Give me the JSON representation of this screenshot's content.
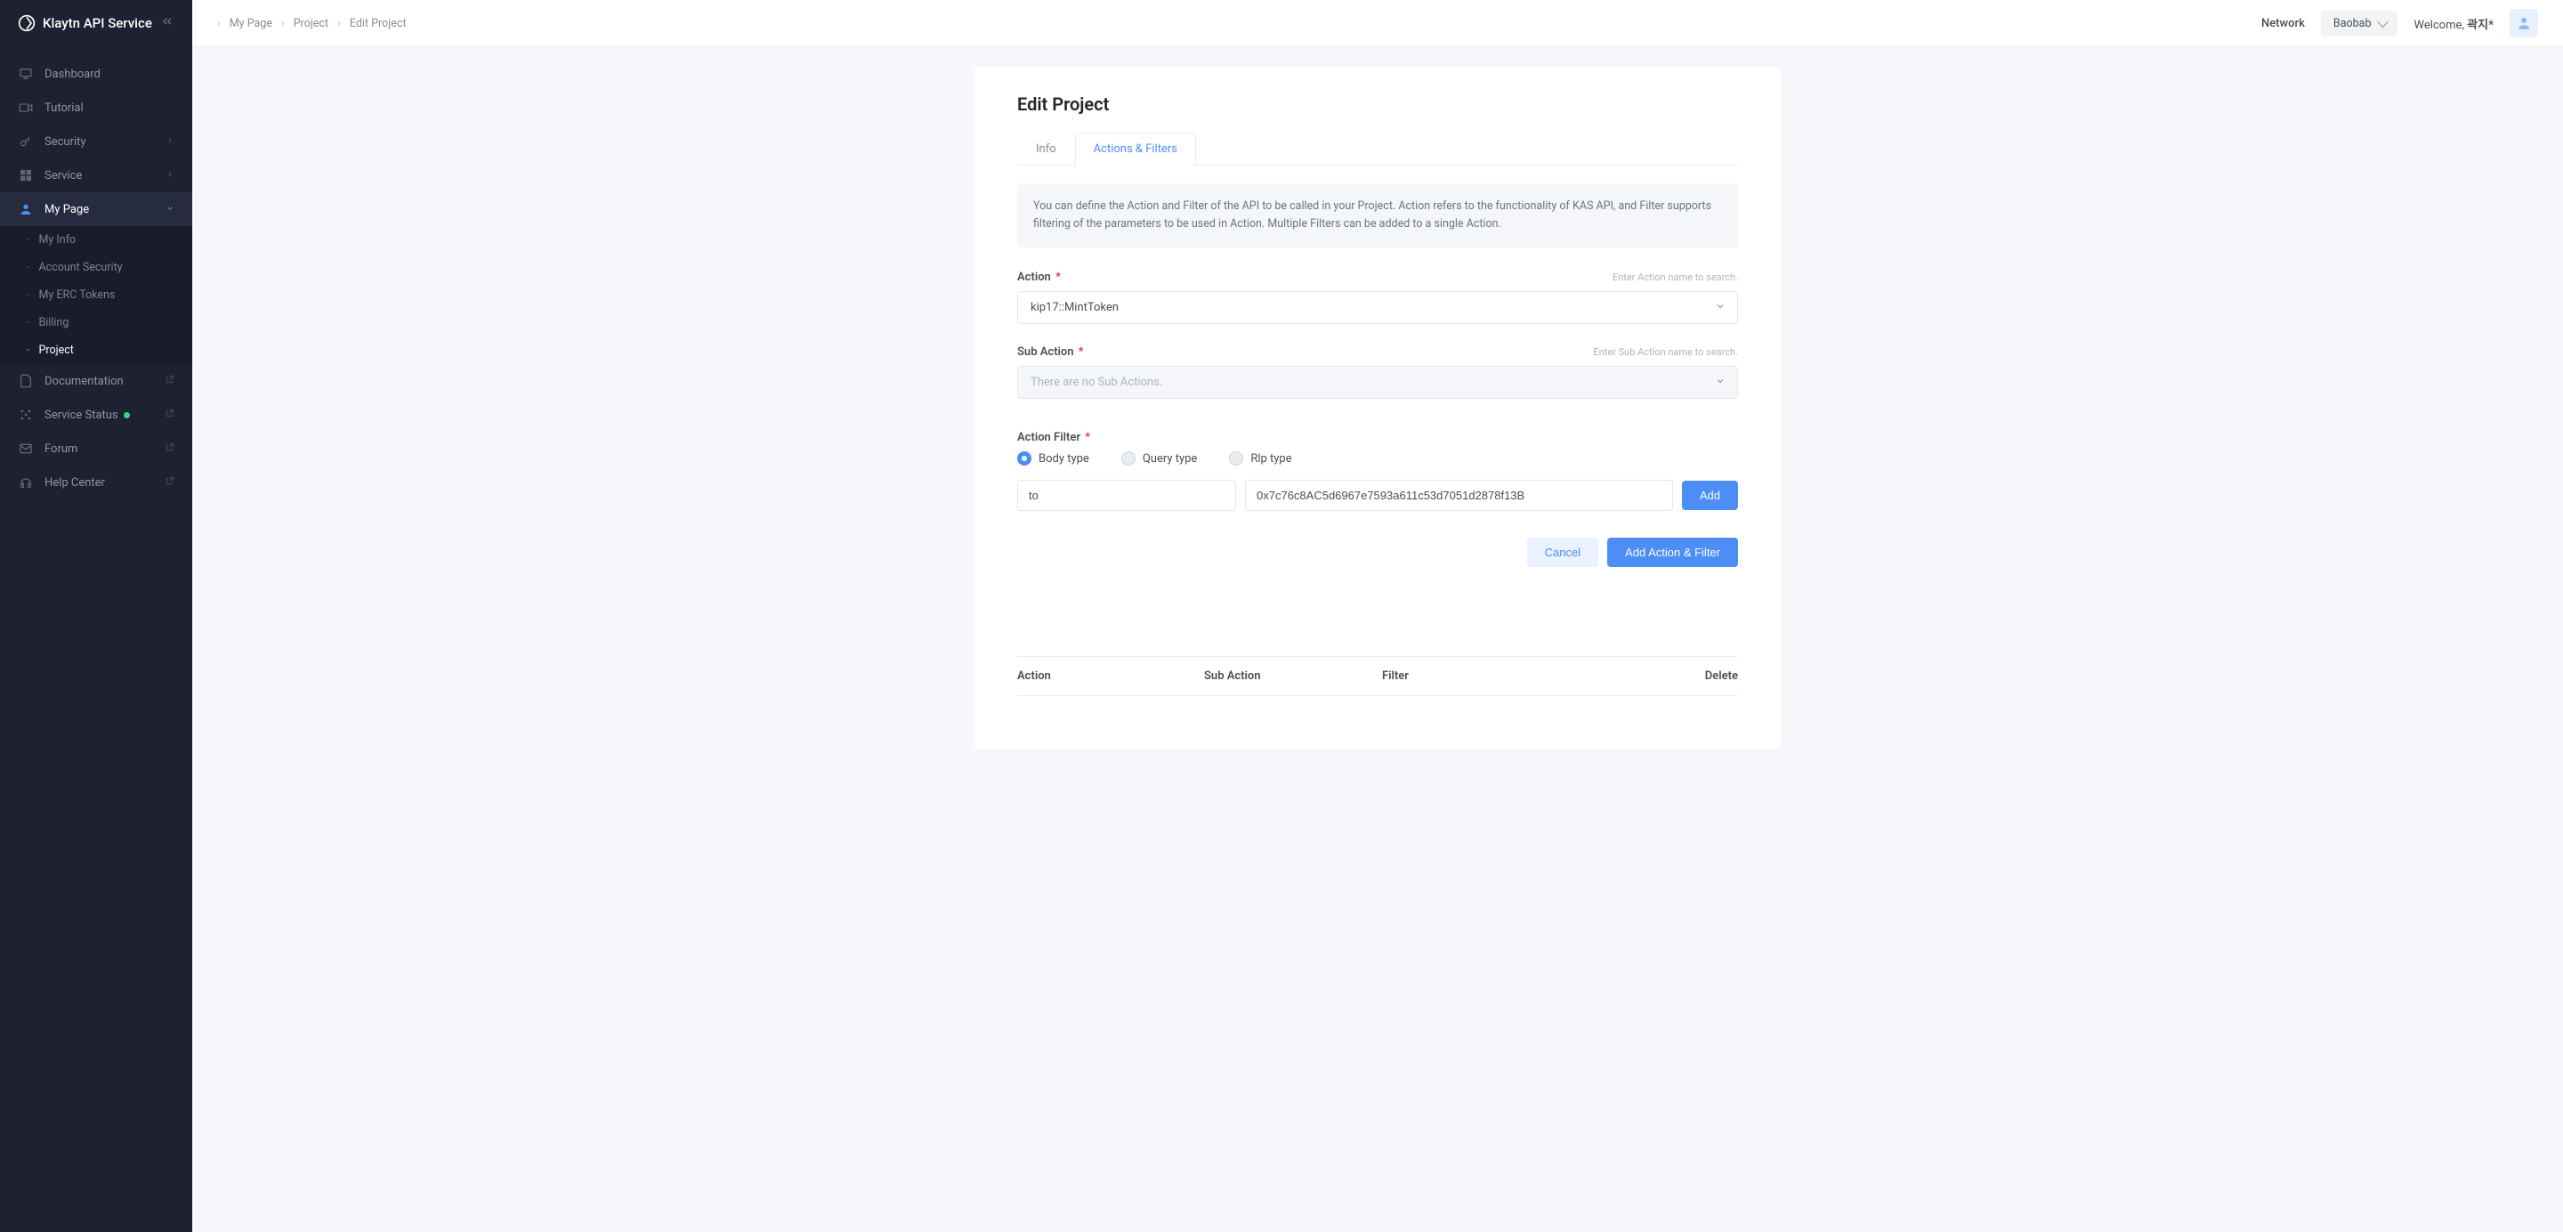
{
  "brand": "Klaytn API Service",
  "sidebar": {
    "items": {
      "dashboard": "Dashboard",
      "tutorial": "Tutorial",
      "security": "Security",
      "service": "Service",
      "mypage": "My Page",
      "documentation": "Documentation",
      "servicestatus": "Service Status",
      "forum": "Forum",
      "helpcenter": "Help Center"
    },
    "sub": {
      "myinfo": "My Info",
      "accountsecurity": "Account Security",
      "myerctokens": "My ERC Tokens",
      "billing": "Billing",
      "project": "Project"
    }
  },
  "breadcrumb": {
    "a": "My Page",
    "b": "Project",
    "c": "Edit Project"
  },
  "header": {
    "networkLabel": "Network",
    "networkValue": "Baobab",
    "welcomePrefix": "Welcome, ",
    "username": "곽지*"
  },
  "page": {
    "title": "Edit Project",
    "tabs": {
      "info": "Info",
      "actions": "Actions & Filters"
    },
    "banner": "You can define the Action and Filter of the API to be called in your Project. Action refers to the functionality of KAS API, and Filter supports filtering of the parameters to be used in Action. Multiple Filters can be added to a single Action.",
    "action": {
      "label": "Action",
      "hint": "Enter Action name to search.",
      "value": "kip17::MintToken"
    },
    "subaction": {
      "label": "Sub Action",
      "hint": "Enter Sub Action name to search.",
      "placeholder": "There are no Sub Actions."
    },
    "filter": {
      "label": "Action Filter",
      "radios": {
        "body": "Body type",
        "query": "Query type",
        "rlp": "Rlp type"
      },
      "key": "to",
      "value": "0x7c76c8AC5d6967e7593a611c53d7051d2878f13B",
      "addBtn": "Add"
    },
    "buttons": {
      "cancel": "Cancel",
      "submit": "Add Action & Filter"
    },
    "table": {
      "action": "Action",
      "sub": "Sub Action",
      "filter": "Filter",
      "delete": "Delete"
    }
  }
}
